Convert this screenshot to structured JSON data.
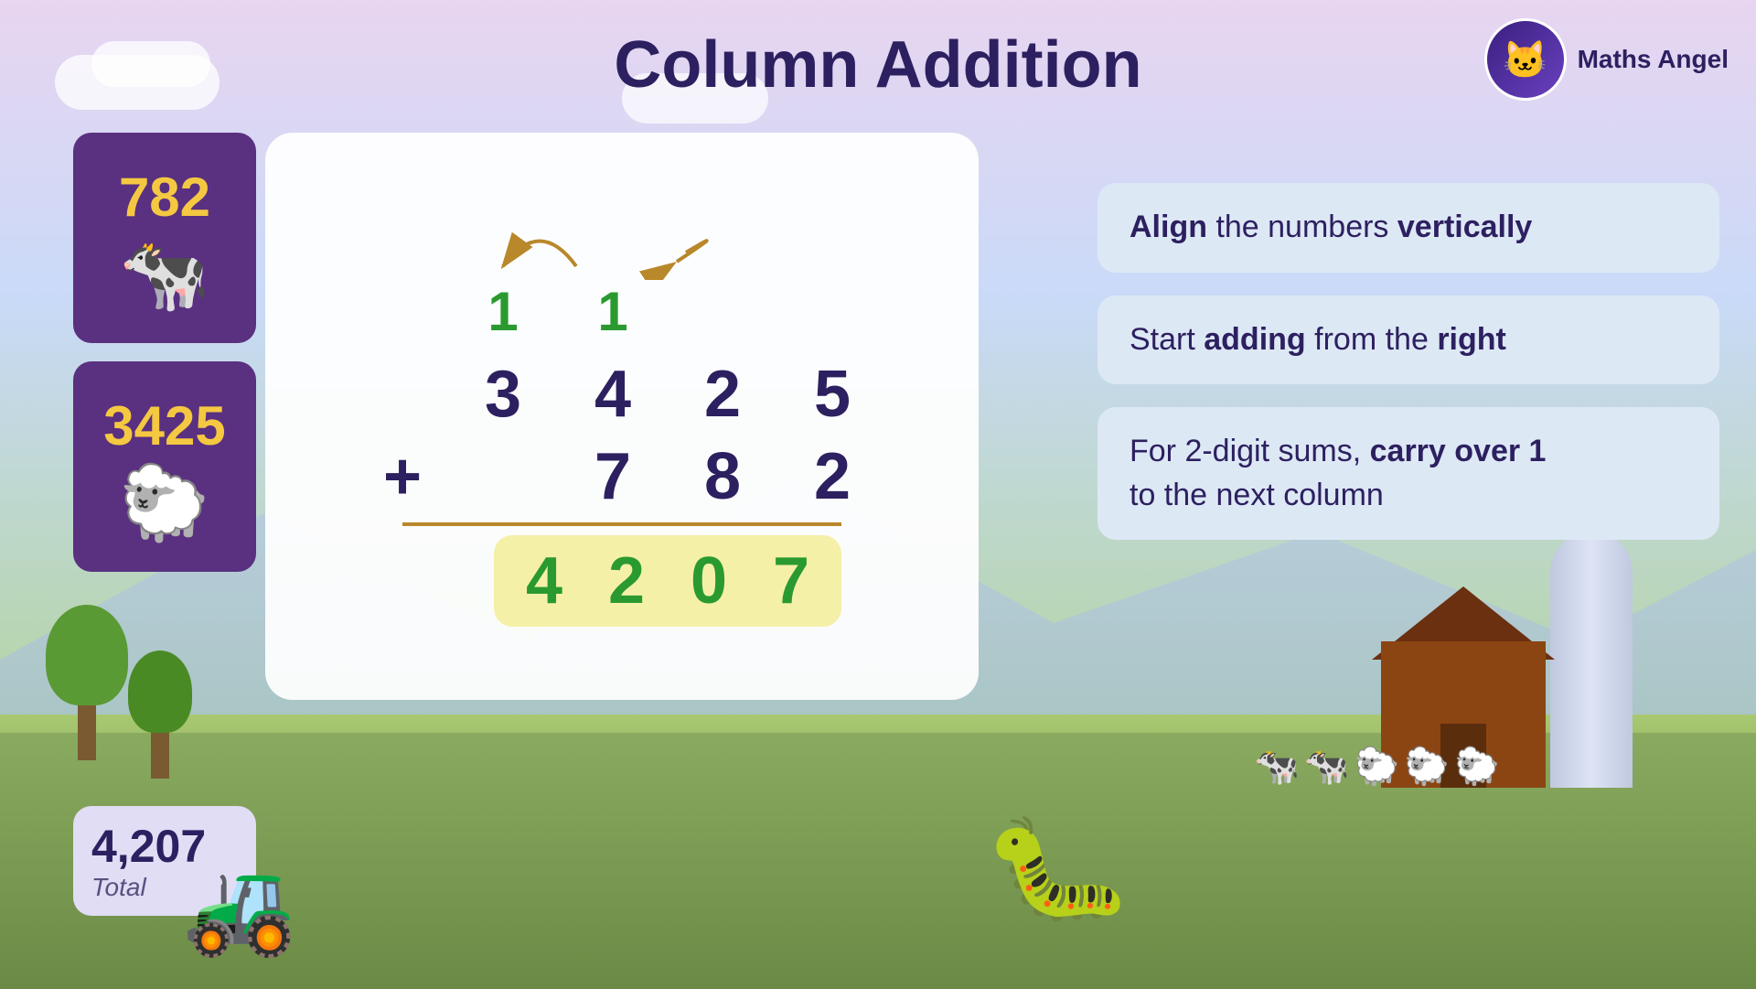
{
  "title": "Column Addition",
  "logo": {
    "icon": "🐱",
    "text": "Maths Angel"
  },
  "numbers": {
    "first": "782",
    "second": "3425",
    "total": "4,207",
    "total_label": "Total"
  },
  "addition": {
    "carry_1a": "1",
    "carry_1b": "1",
    "row1": [
      "3",
      "4",
      "2",
      "5"
    ],
    "row2": [
      "7",
      "8",
      "2"
    ],
    "result": [
      "4",
      "2",
      "0",
      "7"
    ],
    "plus_sign": "+"
  },
  "info_boxes": [
    {
      "id": "box1",
      "text_before": "",
      "bold1": "Align",
      "text_middle": " the numbers ",
      "bold2": "vertically"
    },
    {
      "id": "box2",
      "text_before": "Start ",
      "bold1": "adding",
      "text_middle": " from the ",
      "bold2": "right"
    },
    {
      "id": "box3",
      "text_before": "For 2-digit sums, ",
      "bold1": "carry over 1",
      "text_middle": " to the next column"
    }
  ]
}
